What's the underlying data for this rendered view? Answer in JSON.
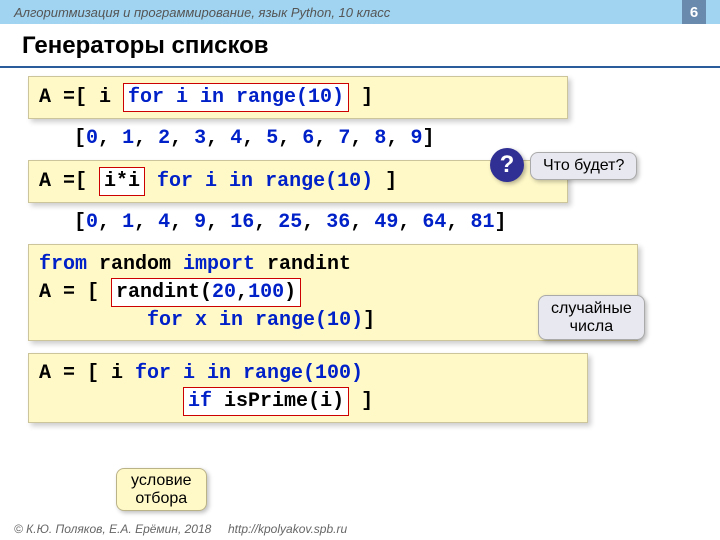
{
  "header": {
    "course": "Алгоритмизация и программирование, язык Python, 10 класс",
    "page": "6"
  },
  "title": "Генераторы списков",
  "blocks": {
    "b1_pre": "A =[ i ",
    "b1_hl": "for i in range(10)",
    "b1_post": " ]",
    "out1": "[0, 1, 2, 3, 4, 5, 6, 7, 8, 9]",
    "b2_pre": "A =[ ",
    "b2_hl": "i*i",
    "b2_mid": "  ",
    "b2_for": "for i in range(10)",
    "b2_post": " ]",
    "out2": "[0, 1, 4, 9, 16, 25, 36, 49, 64, 81]",
    "b3_l1_from": "from",
    "b3_l1_mod": " random ",
    "b3_l1_imp": "import",
    "b3_l1_name": " randint",
    "b3_l2_pre": "A = [ ",
    "b3_l2_hl_fn": "randint(",
    "b3_l2_hl_a1": "20",
    "b3_l2_hl_c": ",",
    "b3_l2_hl_a2": "100",
    "b3_l2_hl_close": ")",
    "b3_l3_indent": "         ",
    "b3_l3_for": "for x in range(10)",
    "b3_l3_post": "]",
    "b4_l1_pre": "A = [ i ",
    "b4_l1_for": "for i in range(100)",
    "b4_l2_indent": "            ",
    "b4_l2_hl_if": "if",
    "b4_l2_hl_rest": " isPrime(i)",
    "b4_l2_post": " ]"
  },
  "callouts": {
    "q_mark": "?",
    "q_text": "Что будет?",
    "random_l1": "случайные",
    "random_l2": "числа",
    "filter_l1": "условие",
    "filter_l2": "отбора"
  },
  "footer": {
    "copyright": "© К.Ю. Поляков, Е.А. Ерёмин, 2018",
    "url": "http://kpolyakov.spb.ru"
  }
}
